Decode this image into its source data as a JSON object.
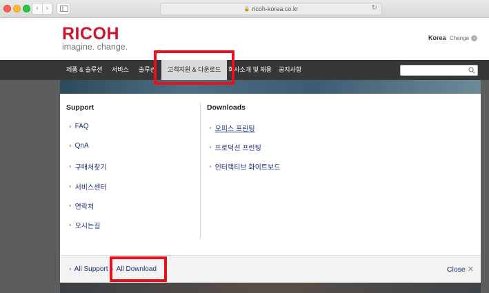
{
  "browser": {
    "url": "ricoh-korea.co.kr",
    "back_icon": "‹",
    "forward_icon": "›",
    "lock_icon": "🔒",
    "reload_icon": "↻"
  },
  "header": {
    "logo": "RICOH",
    "tagline": "imagine. change.",
    "region": "Korea",
    "change_label": "Change",
    "change_icon": "›"
  },
  "nav": {
    "items": [
      {
        "label": "제품 & 솔루션"
      },
      {
        "label": "서비스"
      },
      {
        "label": "솔루션"
      },
      {
        "label": "고객지원 & 다운로드"
      },
      {
        "label": "회사소개 및 채용"
      },
      {
        "label": "공지사항"
      }
    ],
    "search_placeholder": ""
  },
  "panel": {
    "support": {
      "title": "Support",
      "links": [
        {
          "label": "FAQ"
        },
        {
          "label": "QnA"
        },
        {
          "label": "구매처찾기"
        },
        {
          "label": "서비스센터"
        },
        {
          "label": "연락처"
        },
        {
          "label": "오시는길"
        }
      ]
    },
    "downloads": {
      "title": "Downloads",
      "links": [
        {
          "label": "오피스 프린팅"
        },
        {
          "label": "프로덕션 프린팅"
        },
        {
          "label": "인터랙티브 화이트보드"
        }
      ]
    },
    "footer": {
      "all_support": "All Support",
      "all_download": "All Download",
      "close": "Close",
      "close_icon": "✕"
    },
    "chevron": "›"
  },
  "colors": {
    "brand_red": "#cf142b",
    "nav_bg": "#373737",
    "link_blue": "#1a2f7a",
    "highlight_red": "#e8101b"
  }
}
